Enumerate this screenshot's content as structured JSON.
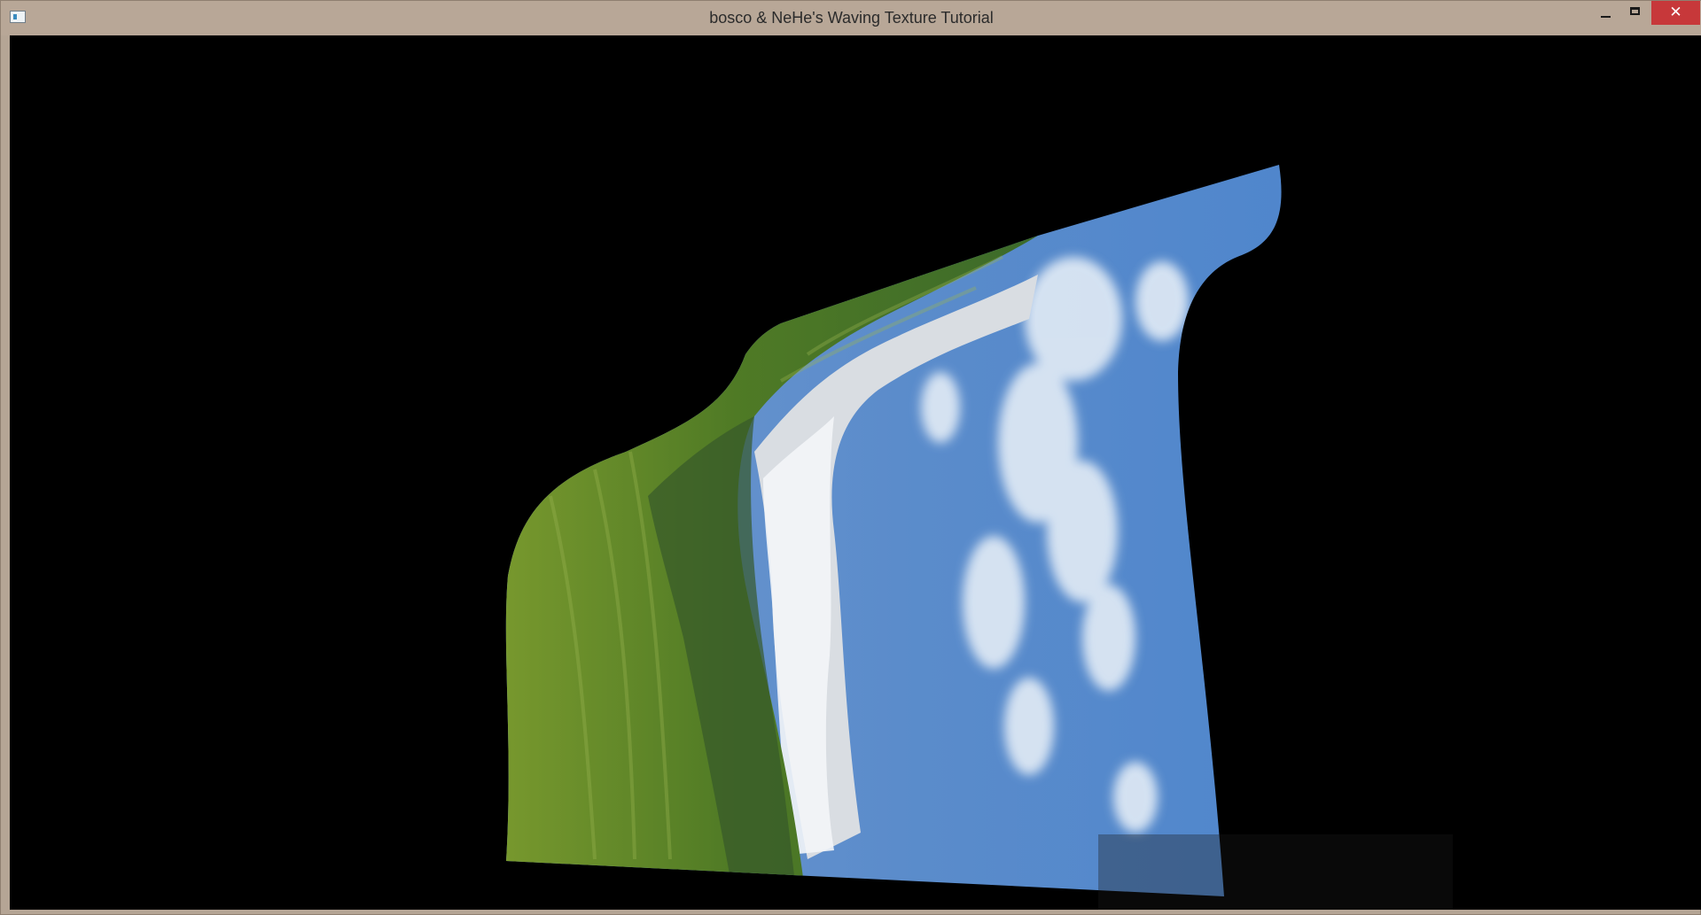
{
  "window": {
    "title": "bosco & NeHe's Waving Texture Tutorial"
  },
  "controls": {
    "minimize_icon": "minimize-icon",
    "maximize_icon": "maximize-icon",
    "close_icon": "close-icon",
    "close_glyph": "✕"
  },
  "colors": {
    "titlebar": "#b8a797",
    "close": "#c7383a",
    "viewport_background": "#000000"
  }
}
